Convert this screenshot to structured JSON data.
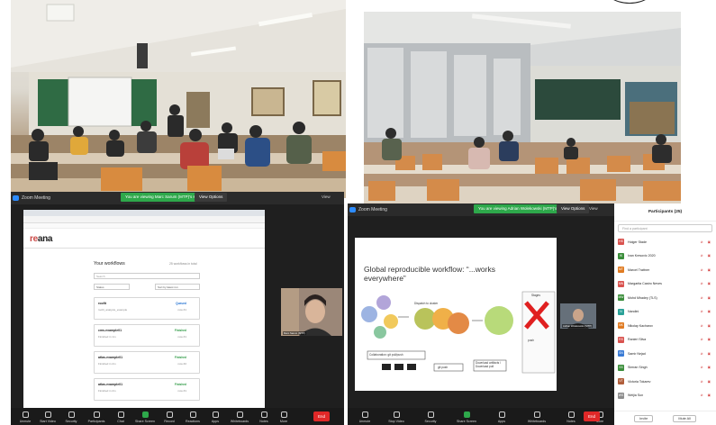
{
  "zoom_left": {
    "title": "Zoom Meeting",
    "share_banner": "You are viewing Marc Sarum (MTP)'s screen",
    "view_options": "View Options",
    "view": "View",
    "end": "End",
    "toolbar": [
      "Unmute",
      "Start Video",
      "Security",
      "Participants",
      "Chat",
      "Share Screen",
      "Record",
      "Reactions",
      "Apps",
      "Whiteboards",
      "Notes",
      "More"
    ]
  },
  "zoom_right": {
    "title": "Zoom Meeting",
    "share_banner": "You are viewing Adrian Wolekowski (MTP)'s screen",
    "view_options": "View Options",
    "view": "View",
    "end": "End",
    "toolbar": [
      "Unmute",
      "Stop Video",
      "Security",
      "Share Screen",
      "Apps",
      "Whiteboards",
      "Notes",
      "More"
    ]
  },
  "reana": {
    "logo_prefix": "re",
    "logo_suffix": "ana",
    "page_title": "Your workflows",
    "count": "25 workflows in total",
    "search_placeholder": "Search",
    "filter_status": "Status",
    "filter_sort": "Sort by latest run",
    "workflows": [
      {
        "name": "roofit",
        "sub": "roofit_analysis_example",
        "status": "Queued",
        "time": "now #1"
      },
      {
        "name": "cms-example01",
        "sub": "Finished in 1m",
        "status": "Finished",
        "time": "now #1"
      },
      {
        "name": "atlas-example01",
        "sub": "Finished in 2m",
        "status": "Finished",
        "time": "now #2"
      },
      {
        "name": "atlas-example01",
        "sub": "Finished in 2m",
        "status": "Finished",
        "time": "now #1"
      }
    ]
  },
  "cam_left_name": "Marc Sarum (MTP)",
  "cam_right_name": "Adrian Wolekowski (MTP)",
  "slide": {
    "title": "Global reproducible workflow: “...works everywhere”",
    "collaboration": "Collaboration: git pull/push",
    "git_push": "git push",
    "download": "Download artifacts / Download pull",
    "dispatch": "Dispatch to cluster",
    "stages": "Stages",
    "push": "push"
  },
  "participants": {
    "header": "Participants (25)",
    "find_placeholder": "Find a participant",
    "invite": "Invite",
    "mute_all": "Mute All",
    "list": [
      {
        "initial": "HS",
        "name": "Holger Stade",
        "color": "#d9534f"
      },
      {
        "initial": "IK",
        "name": "Ivan Kresovic 2020",
        "color": "#3b8e3b"
      },
      {
        "initial": "MT",
        "name": "Marcel Trattner",
        "color": "#e07b22"
      },
      {
        "initial": "MN",
        "name": "Margarita Castro Neves",
        "color": "#d9534f"
      },
      {
        "initial": "MW",
        "name": "Mohd Mhadey (TLS)",
        "color": "#3b8e3b"
      },
      {
        "initial": "N",
        "name": "Nandini",
        "color": "#2aa198"
      },
      {
        "initial": "NK",
        "name": "Nikolay Kacharov",
        "color": "#e07b22"
      },
      {
        "initial": "RS",
        "name": "Ranieri Silva",
        "color": "#d9534f"
      },
      {
        "initial": "SN",
        "name": "Samir Nejad",
        "color": "#3a7bd5"
      },
      {
        "initial": "SS",
        "name": "Simran Singh",
        "color": "#3b8e3b"
      },
      {
        "initial": "VT",
        "name": "Victoria Tokarev",
        "color": "#b05e3a"
      },
      {
        "initial": "WS",
        "name": "Weijia Sun",
        "color": "#8d8d8d"
      }
    ]
  }
}
